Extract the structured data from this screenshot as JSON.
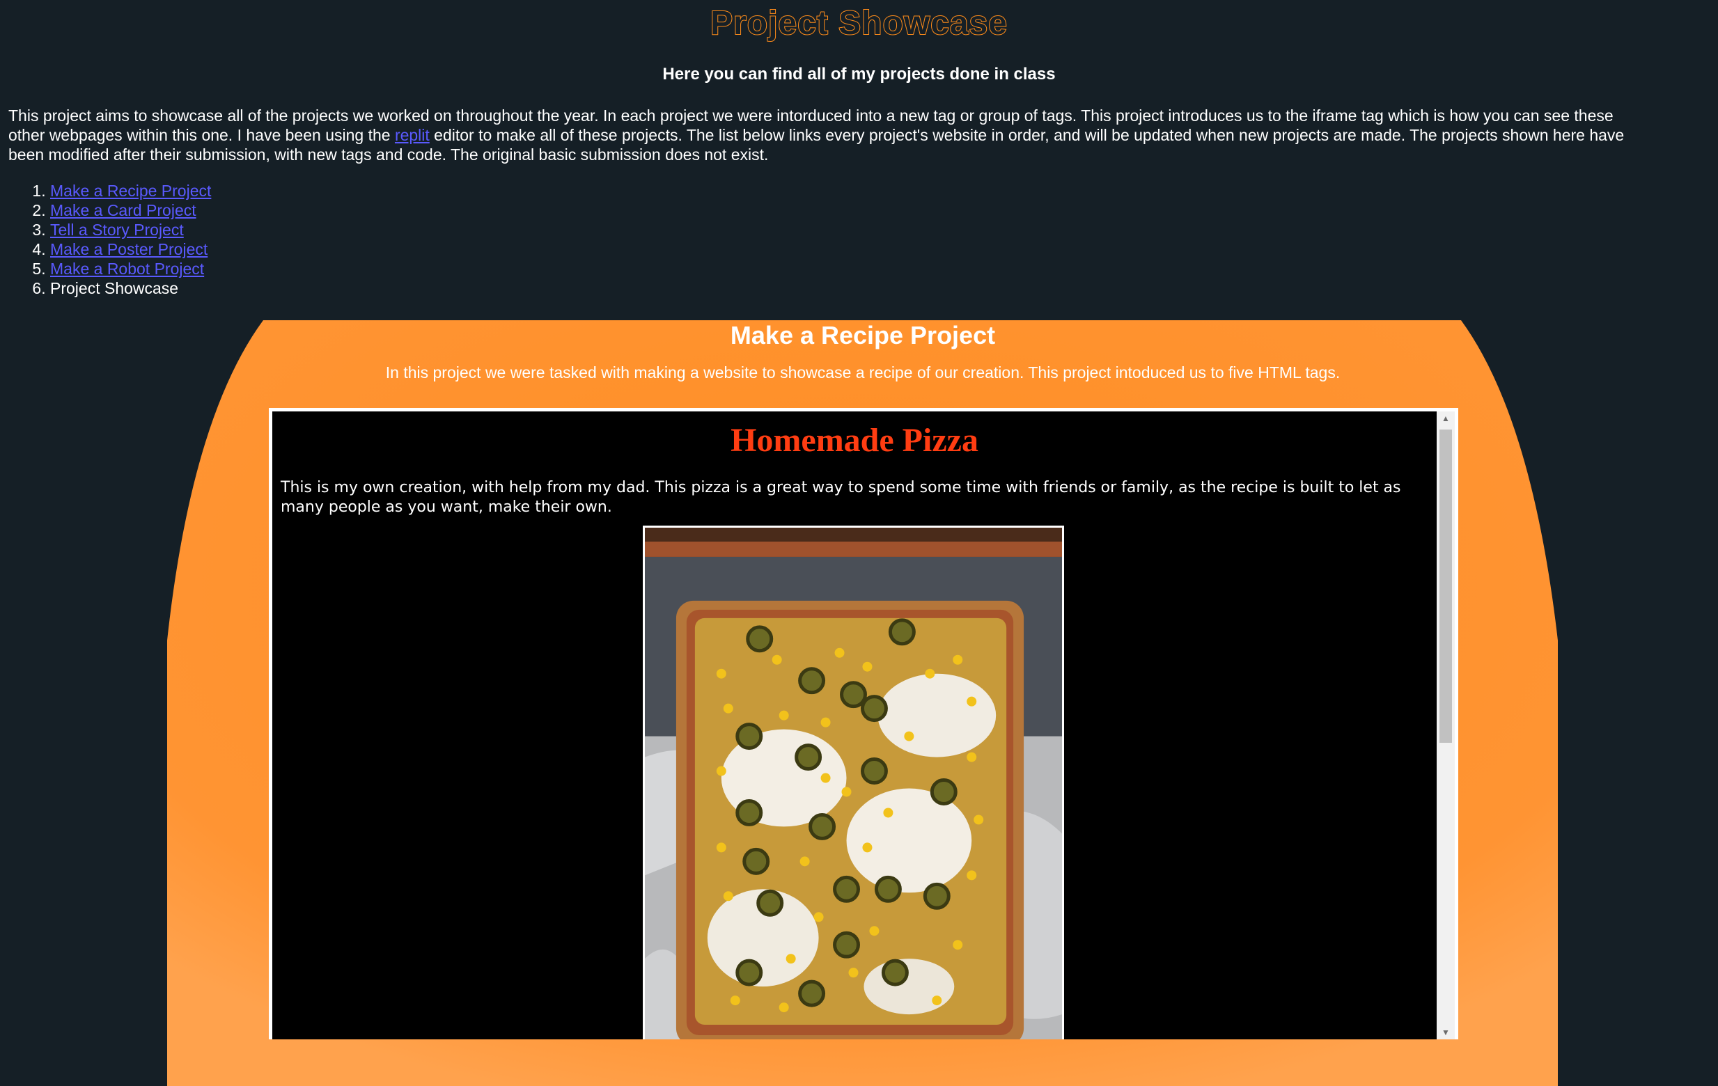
{
  "header": {
    "title": "Project Showcase",
    "subtitle": "Here you can find all of my projects done in class"
  },
  "intro": {
    "line1": "This project aims to showcase all of the projects we worked on throughout the year. In each project we were intorduced into a new tag or group of tags. This project introduces us to the iframe tag which is how you can see these",
    "line2_before": "other webpages within this one. I have been using the ",
    "line2_link": "replit",
    "line2_after": " editor to make all of these projects. The list below links every project's website in order, and will be updated when new projects are made. The projects shown here have",
    "line3": "been modified after their submission, with new tags and code. The original basic submission does not exist."
  },
  "projects": [
    {
      "label": "Make a Recipe Project",
      "is_link": true
    },
    {
      "label": "Make a Card Project",
      "is_link": true
    },
    {
      "label": "Tell a Story Project",
      "is_link": true
    },
    {
      "label": "Make a Poster Project",
      "is_link": true
    },
    {
      "label": "Make a Robot Project",
      "is_link": true
    },
    {
      "label": "Project Showcase",
      "is_link": false
    }
  ],
  "showcase_card": {
    "title": "Make a Recipe Project",
    "description": "In this project we were tasked with making a website to showcase a recipe of our creation. This project intoduced us to five HTML tags."
  },
  "embedded_page": {
    "title": "Homemade Pizza",
    "description": "This is my own creation, with help from my dad. This pizza is a great way to spend some time with friends or family, as the recipe is built to let as many people as you want, make their own.",
    "photo_icon": "pizza-photo"
  },
  "colors": {
    "background": "#151f26",
    "accent_orange": "#ff8c1a",
    "link": "#5a5aff",
    "pizza_title": "#ff3d12"
  }
}
